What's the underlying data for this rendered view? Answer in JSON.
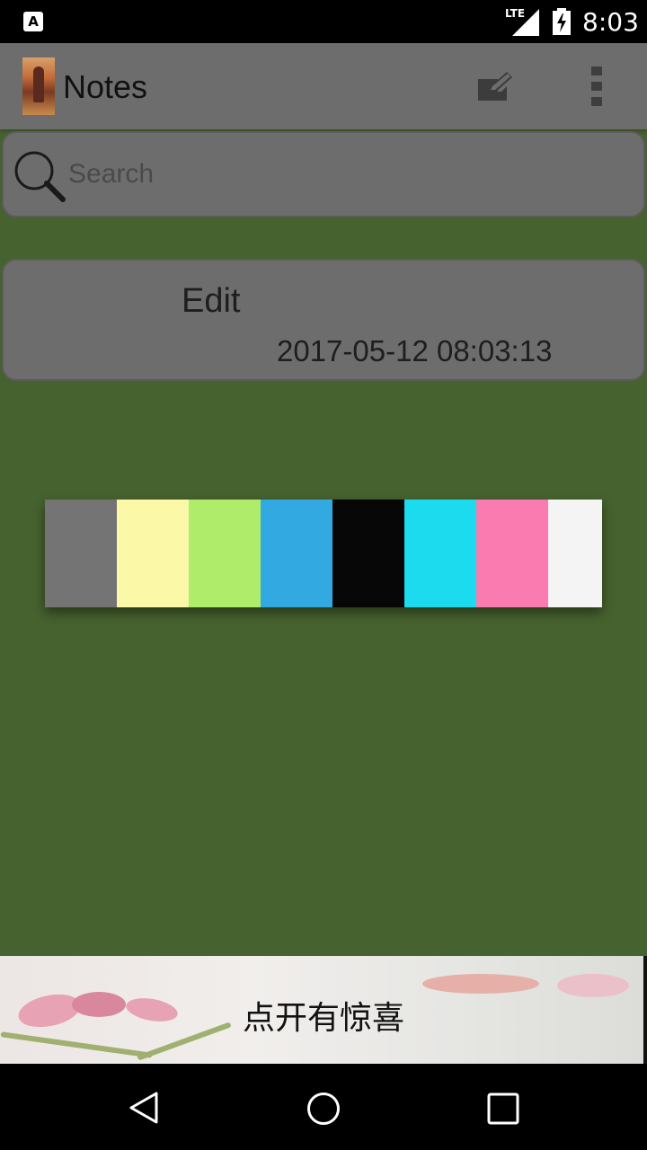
{
  "status_bar": {
    "time": "8:03",
    "network": "LTE",
    "notification_icon": "a-icon"
  },
  "app_bar": {
    "title": "Notes",
    "icons": [
      "compose-icon",
      "more-vert-icon"
    ]
  },
  "search": {
    "placeholder": "Search"
  },
  "notes": [
    {
      "title": "Edit",
      "date": "2017-05-12 08:03:13"
    }
  ],
  "palette": {
    "colors": [
      "#747474",
      "#fbf8a8",
      "#aeec6a",
      "#32a9e1",
      "#070707",
      "#1ddbee",
      "#f97bb0",
      "#f4f4f4"
    ]
  },
  "banner": {
    "text": "点开有惊喜"
  },
  "nav_bar": {
    "icons": [
      "back-icon",
      "home-icon",
      "recents-icon"
    ]
  }
}
